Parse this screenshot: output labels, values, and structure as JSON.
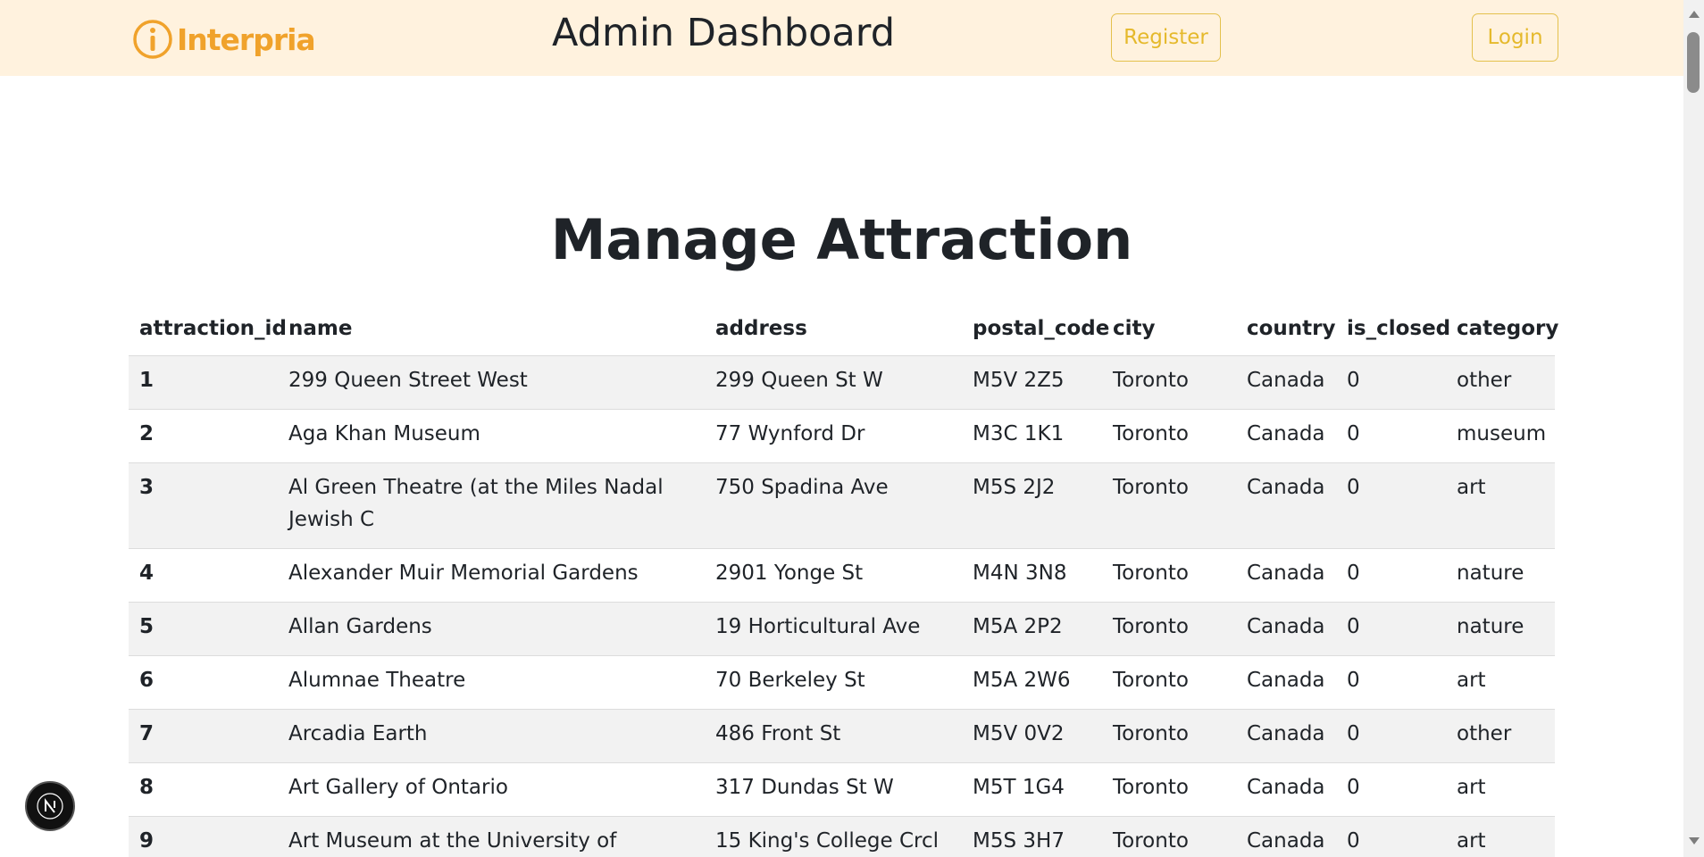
{
  "header": {
    "logo_text": "Interpria",
    "title": "Admin Dashboard",
    "register_label": "Register",
    "login_label": "Login",
    "accent_color": "#f0a22b",
    "background_color": "#fff2de"
  },
  "main": {
    "title": "Manage Attraction",
    "columns": [
      "attraction_id",
      "name",
      "address",
      "postal_code",
      "city",
      "country",
      "is_closed",
      "category"
    ],
    "rows": [
      [
        "1",
        "299 Queen Street West",
        "299 Queen St W",
        "M5V 2Z5",
        "Toronto",
        "Canada",
        "0",
        "other"
      ],
      [
        "2",
        "Aga Khan Museum",
        "77 Wynford Dr",
        "M3C 1K1",
        "Toronto",
        "Canada",
        "0",
        "museum"
      ],
      [
        "3",
        "Al Green Theatre (at the Miles Nadal Jewish C",
        "750 Spadina Ave",
        "M5S 2J2",
        "Toronto",
        "Canada",
        "0",
        "art"
      ],
      [
        "4",
        "Alexander Muir Memorial Gardens",
        "2901 Yonge St",
        "M4N 3N8",
        "Toronto",
        "Canada",
        "0",
        "nature"
      ],
      [
        "5",
        "Allan Gardens",
        "19 Horticultural Ave",
        "M5A 2P2",
        "Toronto",
        "Canada",
        "0",
        "nature"
      ],
      [
        "6",
        "Alumnae Theatre",
        "70 Berkeley St",
        "M5A 2W6",
        "Toronto",
        "Canada",
        "0",
        "art"
      ],
      [
        "7",
        "Arcadia Earth",
        "486 Front St",
        "M5V 0V2",
        "Toronto",
        "Canada",
        "0",
        "other"
      ],
      [
        "8",
        "Art Gallery of Ontario",
        "317 Dundas St W",
        "M5T 1G4",
        "Toronto",
        "Canada",
        "0",
        "art"
      ],
      [
        "9",
        "Art Museum at the University of Toronto",
        "15 King's College Crcl",
        "M5S 3H7",
        "Toronto",
        "Canada",
        "0",
        "art"
      ]
    ]
  },
  "floating_badge": {
    "label": "N",
    "icon": "nextjs-icon"
  }
}
